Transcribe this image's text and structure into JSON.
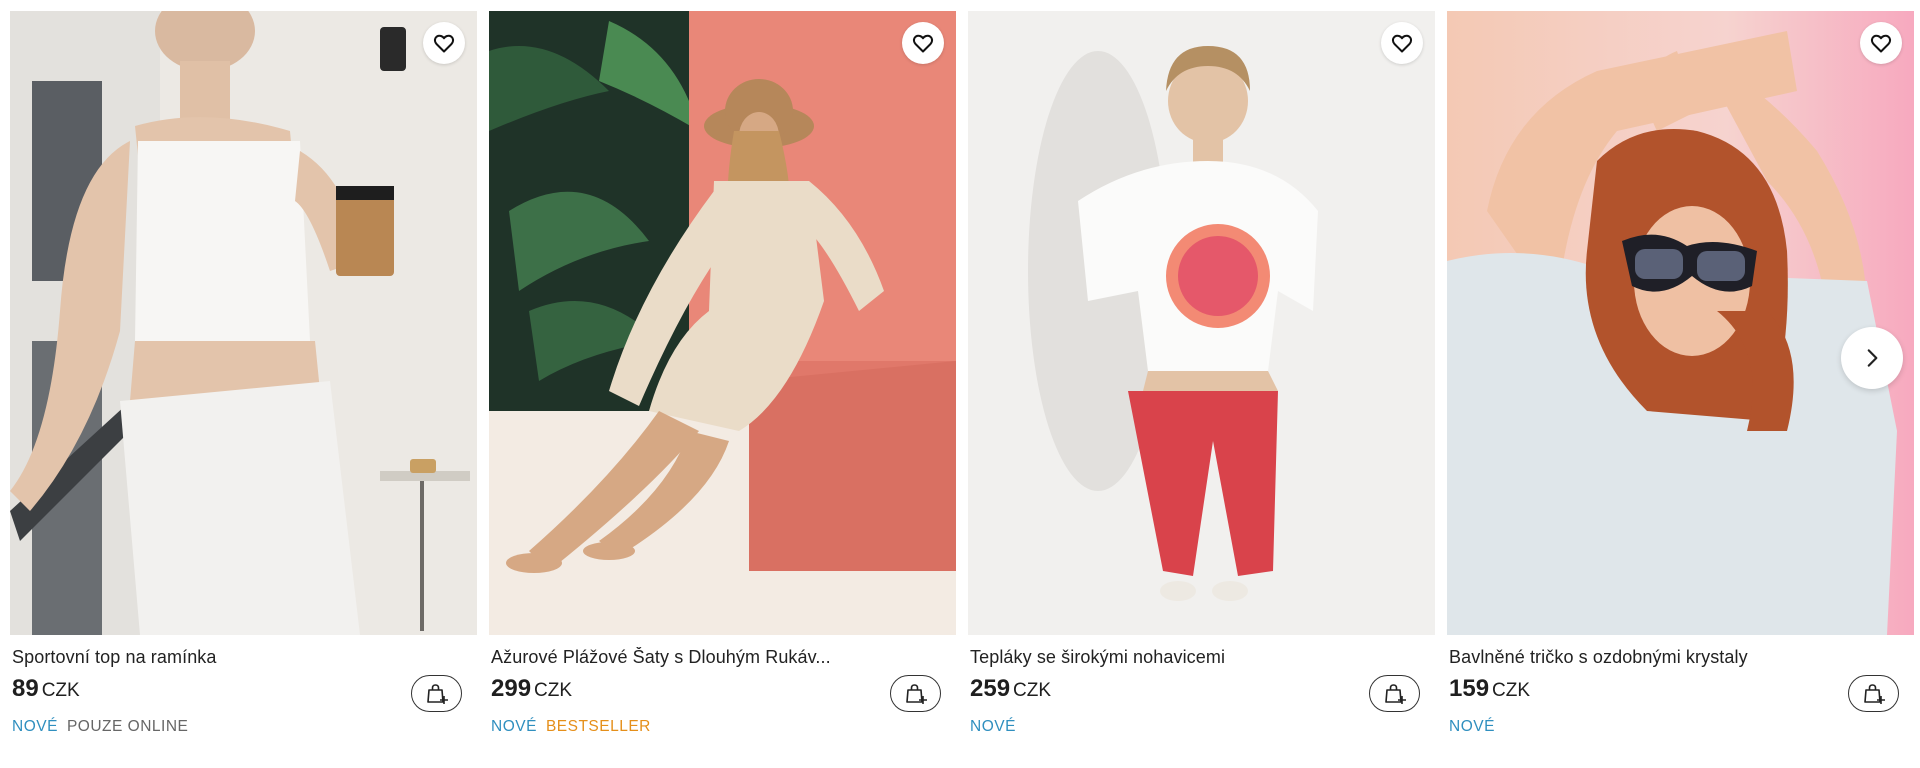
{
  "products": [
    {
      "title": "Sportovní top na ramínka",
      "price": "89",
      "currency": "CZK",
      "badges": [
        "NOVÉ",
        "POUZE ONLINE"
      ],
      "photo": "woman in white sports top and leggings holding coffee cup on balcony"
    },
    {
      "title": "Ažurové Plážové Šaty s Dlouhým Rukáv...",
      "price": "299",
      "currency": "CZK",
      "badges": [
        "NOVÉ",
        "BESTSELLER"
      ],
      "photo": "woman in crochet beach dress and sun hat sitting by pink wall with palm leaves"
    },
    {
      "title": "Tepláky se širokými nohavicemi",
      "price": "259",
      "currency": "CZK",
      "badges": [
        "NOVÉ"
      ],
      "photo": "woman in white printed t-shirt and red sweatpants"
    },
    {
      "title": "Bavlněné tričko s ozdobnými krystaly",
      "price": "159",
      "currency": "CZK",
      "badges": [
        "NOVÉ"
      ],
      "photo": "woman with red hair and sunglasses in light blue t-shirt on pink background"
    }
  ],
  "icons": {
    "favorite": "heart-outline-icon",
    "cart": "shopping-bag-plus-icon",
    "next": "chevron-right-icon"
  },
  "colors": {
    "badge_new": "#2f8fbf",
    "badge_bestseller": "#e58f1a",
    "badge_online": "#666666"
  }
}
